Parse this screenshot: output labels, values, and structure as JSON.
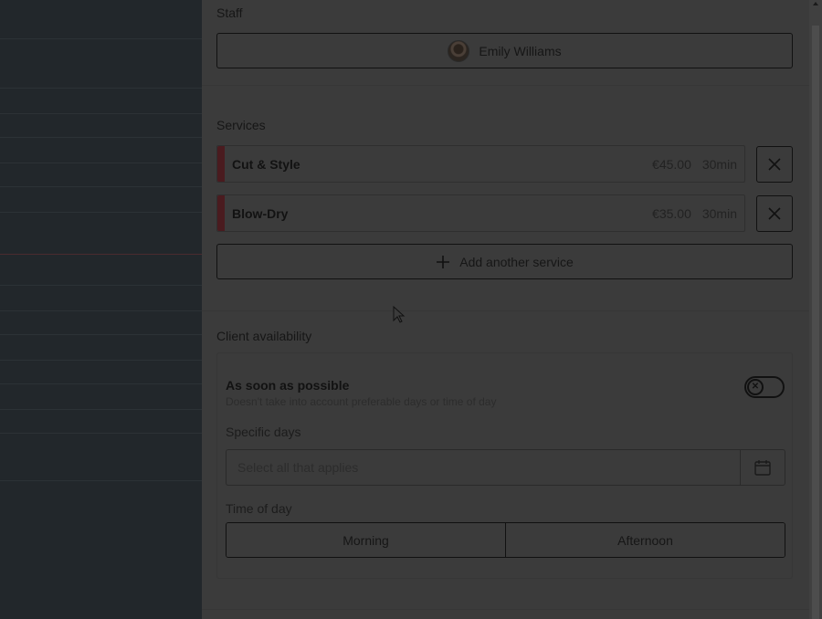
{
  "staff": {
    "section_label": "Staff",
    "selected_name": "Emily Williams"
  },
  "services": {
    "section_label": "Services",
    "items": [
      {
        "name": "Cut & Style",
        "price": "€45.00",
        "duration": "30min"
      },
      {
        "name": "Blow-Dry",
        "price": "€35.00",
        "duration": "30min"
      }
    ],
    "add_label": "Add another service"
  },
  "availability": {
    "section_label": "Client availability",
    "asap_title": "As soon as possible",
    "asap_subtitle": "Doesn't take into account preferable days or time of day",
    "asap_enabled": false,
    "specific_days_label": "Specific days",
    "specific_days_placeholder": "Select all that applies",
    "time_of_day_label": "Time of day",
    "time_options": [
      "Morning",
      "Afternoon"
    ]
  },
  "colors": {
    "overlay": "#3b3b3b",
    "service_accent": "#4a1b1f",
    "backdrop": "#22272b"
  },
  "icons": {
    "remove": "close-icon",
    "add": "plus-icon",
    "calendar": "calendar-icon",
    "toggle_off": "x-icon"
  }
}
